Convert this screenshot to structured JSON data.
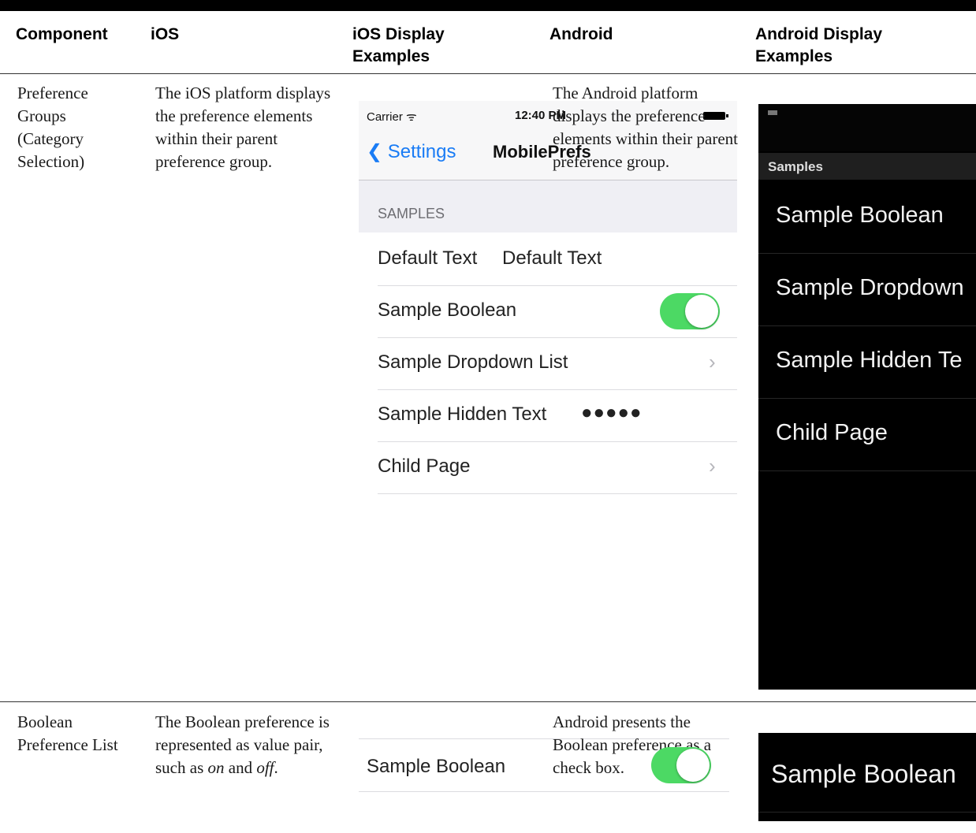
{
  "table": {
    "headers": {
      "component": "Component",
      "ios": "iOS",
      "ios_display": "iOS Display Examples",
      "android": "Android",
      "android_display": "Android Display Examples"
    },
    "rows": [
      {
        "component": "Preference Groups (Category Selection)",
        "ios": "The iOS platform displays the preference elements within their parent preference group.",
        "android": "The Android platform displays the preference elements within their parent preference group."
      },
      {
        "component": "Boolean Preference List",
        "ios_prefix": "The Boolean preference is represented as value pair, such as ",
        "ios_on": "on",
        "ios_and": " and ",
        "ios_off": "off",
        "ios_suffix": ".",
        "android": "Android presents the Boolean preference as a check box."
      }
    ]
  },
  "ios_screen": {
    "carrier": "Carrier ᯤ",
    "time": "12:40 PM",
    "back_label": "Settings",
    "nav_title": "MobilePrefs",
    "section_header": "SAMPLES",
    "rows": [
      {
        "label": "Default Text",
        "value": "Default Text"
      },
      {
        "label": "Sample Boolean",
        "toggle_on": true
      },
      {
        "label": "Sample Dropdown List",
        "chevron": "›"
      },
      {
        "label": "Sample Hidden Text",
        "masked": "●●●●●"
      },
      {
        "label": "Child Page",
        "chevron": "›"
      }
    ],
    "toggle_color": "#4cd964",
    "tint_color": "#1a7cf5"
  },
  "android_screen": {
    "group_title": "Samples",
    "items": [
      "Sample Boolean",
      "Sample Dropdown",
      "Sample Hidden Te",
      "Child Page"
    ]
  },
  "ios_boolean_example": {
    "label": "Sample Boolean",
    "toggle_on": true
  },
  "android_boolean_example": {
    "label": "Sample Boolean"
  }
}
